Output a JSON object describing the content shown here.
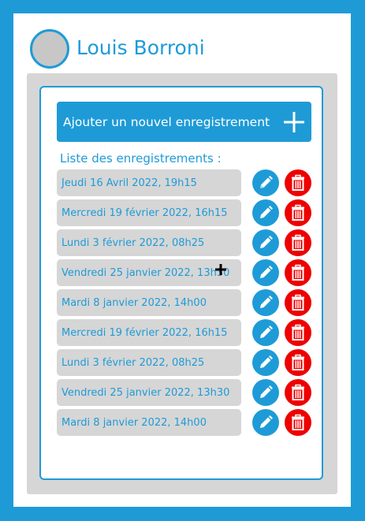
{
  "user": {
    "name": "Louis Borroni"
  },
  "actions": {
    "add_label": "Ajouter un nouvel enregistrement"
  },
  "list": {
    "title": "Liste des enregistrements :",
    "items": [
      {
        "label": "Jeudi 16 Avril 2022, 19h15"
      },
      {
        "label": "Mercredi 19 février 2022, 16h15"
      },
      {
        "label": "Lundi 3 février 2022, 08h25"
      },
      {
        "label": "Vendredi 25 janvier 2022, 13h30"
      },
      {
        "label": "Mardi 8 janvier 2022, 14h00"
      },
      {
        "label": "Mercredi 19 février 2022, 16h15"
      },
      {
        "label": "Lundi 3 février 2022, 08h25"
      },
      {
        "label": "Vendredi 25 janvier 2022, 13h30"
      },
      {
        "label": "Mardi 8 janvier 2022, 14h00"
      }
    ]
  },
  "icons": {
    "add": "plus-icon",
    "edit": "pencil-icon",
    "delete": "trash-icon"
  },
  "colors": {
    "accent": "#1e9bd7",
    "danger": "#ee0000",
    "panel": "#d6d6d6"
  }
}
